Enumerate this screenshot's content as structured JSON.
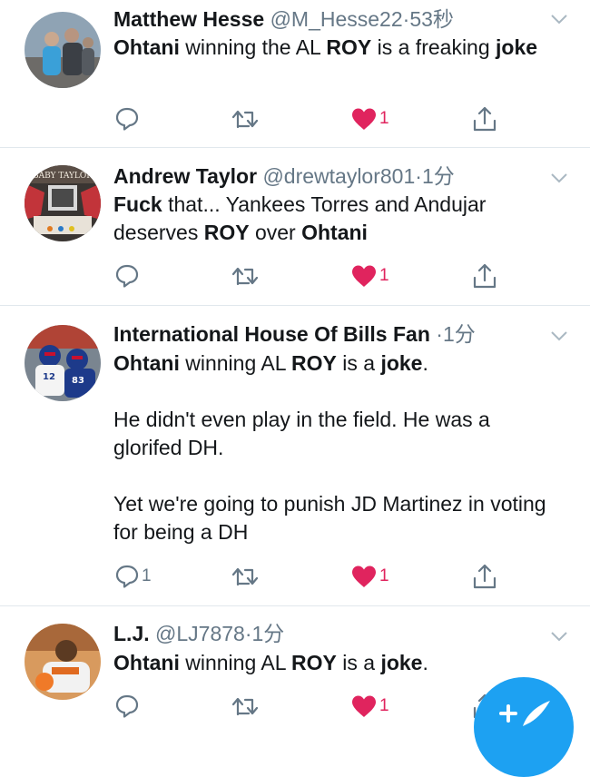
{
  "tweets": [
    {
      "name": "Matthew Hesse",
      "handle": "@M_Hesse22",
      "time": "53秒",
      "body": [
        [
          {
            "t": "Ohtani",
            "b": true
          },
          {
            "t": " winning the AL "
          },
          {
            "t": "ROY",
            "b": true
          },
          {
            "t": " is a freaking "
          },
          {
            "t": "joke",
            "b": true
          }
        ]
      ],
      "reply_count": "",
      "like_count": "1"
    },
    {
      "name": "Andrew Taylor",
      "handle": "@drewtaylor801",
      "time": "1分",
      "avatar_text": "BABY TAYLOR",
      "body": [
        [
          {
            "t": "Fuck",
            "b": true
          },
          {
            "t": " that... Yankees Torres and Andujar deserves "
          },
          {
            "t": "ROY",
            "b": true
          },
          {
            "t": " over "
          },
          {
            "t": "Ohtani",
            "b": true
          }
        ]
      ],
      "reply_count": "",
      "like_count": "1"
    },
    {
      "name": "International House Of Bills Fan",
      "handle": "",
      "time": "1分",
      "body": [
        [
          {
            "t": "Ohtani",
            "b": true
          },
          {
            "t": " winning AL "
          },
          {
            "t": "ROY",
            "b": true
          },
          {
            "t": " is a "
          },
          {
            "t": "joke",
            "b": true
          },
          {
            "t": "."
          }
        ],
        [
          {
            "t": "He didn't even play in the field. He was a glorifed DH."
          }
        ],
        [
          {
            "t": "Yet we're going to punish JD Martinez in voting for being a DH"
          }
        ]
      ],
      "reply_count": "1",
      "like_count": "1"
    },
    {
      "name": "L.J.",
      "handle": "@LJ7878",
      "time": "1分",
      "body": [
        [
          {
            "t": "Ohtani",
            "b": true
          },
          {
            "t": " winning AL "
          },
          {
            "t": "ROY",
            "b": true
          },
          {
            "t": " is a "
          },
          {
            "t": "joke",
            "b": true
          },
          {
            "t": "."
          }
        ]
      ],
      "reply_count": "",
      "like_count": "1"
    }
  ],
  "colors": {
    "like": "#e0245e",
    "icon": "#657786",
    "divider": "#e1e8ed",
    "fab": "#1da1f2"
  }
}
